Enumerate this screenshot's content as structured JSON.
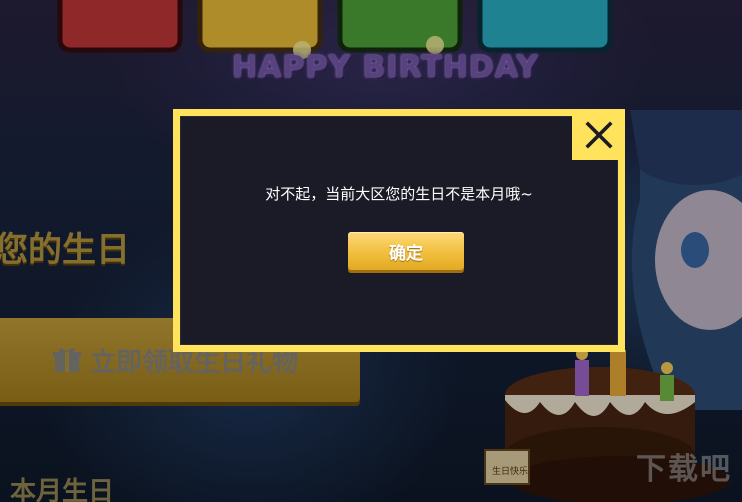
{
  "background": {
    "banner_subtitle": "HAPPY BIRTHDAY",
    "heading": "您的生日",
    "claim_button_label": "立即领取生日礼物",
    "bottom_text": "本月生日",
    "cake_tag": "生日快乐",
    "watermark": "下载吧"
  },
  "dialog": {
    "message": "对不起，当前大区您的生日不是本月哦~",
    "confirm_label": "确定",
    "close_icon": "close-x-icon"
  },
  "colors": {
    "dialog_border": "#ffe35c",
    "dialog_body": "#1b1b27",
    "confirm_button": "#f1bf3e"
  }
}
